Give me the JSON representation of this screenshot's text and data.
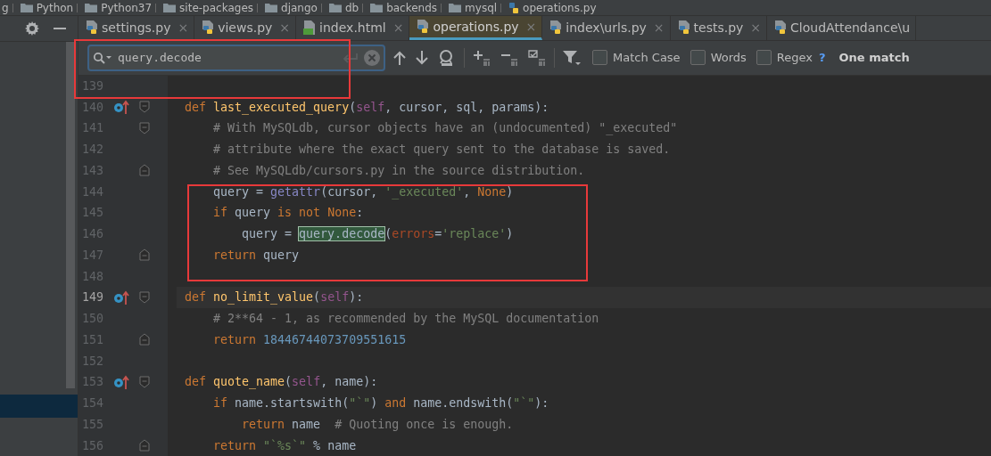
{
  "breadcrumbs": [
    {
      "label": "g",
      "kind": "text"
    },
    {
      "label": "Python",
      "kind": "folder"
    },
    {
      "label": "Python37",
      "kind": "folder"
    },
    {
      "label": "site-packages",
      "kind": "folder"
    },
    {
      "label": "django",
      "kind": "folder"
    },
    {
      "label": "db",
      "kind": "folder"
    },
    {
      "label": "backends",
      "kind": "folder"
    },
    {
      "label": "mysql",
      "kind": "folder"
    },
    {
      "label": "operations.py",
      "kind": "python"
    }
  ],
  "tabs": [
    {
      "label": "settings.py",
      "kind": "python",
      "selected": false,
      "close": "×"
    },
    {
      "label": "views.py",
      "kind": "python",
      "selected": false,
      "close": "×"
    },
    {
      "label": "index.html",
      "kind": "html",
      "selected": false,
      "close": "×"
    },
    {
      "label": "operations.py",
      "kind": "python",
      "selected": true,
      "close": "×"
    },
    {
      "label": "index\\urls.py",
      "kind": "python",
      "selected": false,
      "close": "×"
    },
    {
      "label": "tests.py",
      "kind": "python",
      "selected": false,
      "close": "×"
    },
    {
      "label": "CloudAttendance\\u",
      "kind": "python",
      "selected": false
    }
  ],
  "search": {
    "value": "query.decode",
    "options": [
      {
        "label": "Match Case",
        "checked": false
      },
      {
        "label": "Words",
        "checked": false
      },
      {
        "label": "Regex",
        "checked": false
      }
    ],
    "help": "?",
    "result": "One match"
  },
  "code": {
    "lines": [
      {
        "number": "139"
      },
      {
        "number": "140",
        "marker": true,
        "block_start": true,
        "tokens": [
          {
            "kind": "kw",
            "text": "def "
          },
          {
            "kind": "fn",
            "text": "last_executed_query"
          },
          {
            "kind": "plain",
            "text": "("
          },
          {
            "kind": "self",
            "text": "self"
          },
          {
            "kind": "plain",
            "text": ", cursor, sql, params):"
          }
        ]
      },
      {
        "number": "141",
        "block_start": true,
        "tokens": [
          {
            "kind": "comment",
            "text": "    # With MySQLdb, cursor objects have an (undocumented) \"_executed\""
          }
        ]
      },
      {
        "number": "142",
        "tokens": [
          {
            "kind": "comment",
            "text": "    # attribute where the exact query sent to the database is saved."
          }
        ]
      },
      {
        "number": "143",
        "block_end": true,
        "tokens": [
          {
            "kind": "comment",
            "text": "    # See MySQLdb/cursors.py in the source distribution."
          }
        ]
      },
      {
        "number": "144",
        "tokens": [
          {
            "kind": "plain",
            "text": "    query = "
          },
          {
            "kind": "builtin",
            "text": "getattr"
          },
          {
            "kind": "plain",
            "text": "(cursor, "
          },
          {
            "kind": "string",
            "text": "'_executed'"
          },
          {
            "kind": "plain",
            "text": ", "
          },
          {
            "kind": "kw",
            "text": "None"
          },
          {
            "kind": "plain",
            "text": ")"
          }
        ]
      },
      {
        "number": "145",
        "tokens": [
          {
            "kind": "kw",
            "text": "    if"
          },
          {
            "kind": "plain",
            "text": " query "
          },
          {
            "kind": "kw",
            "text": "is not None"
          },
          {
            "kind": "plain",
            "text": ":"
          }
        ]
      },
      {
        "number": "146",
        "tokens": [
          {
            "kind": "plain",
            "text": "        query = "
          },
          {
            "kind": "match",
            "text": "query.decode"
          },
          {
            "kind": "plain",
            "text": "("
          },
          {
            "kind": "param",
            "text": "errors"
          },
          {
            "kind": "plain",
            "text": "="
          },
          {
            "kind": "string",
            "text": "'replace'"
          },
          {
            "kind": "plain",
            "text": ")"
          }
        ]
      },
      {
        "number": "147",
        "block_end": true,
        "tokens": [
          {
            "kind": "kw",
            "text": "    return"
          },
          {
            "kind": "plain",
            "text": " query"
          }
        ]
      },
      {
        "number": "148"
      },
      {
        "number": "149",
        "marker": true,
        "block_start": true,
        "current": true,
        "tokens": [
          {
            "kind": "kw",
            "text": "def "
          },
          {
            "kind": "fn",
            "text": "no_limit_value"
          },
          {
            "kind": "plain",
            "text": "("
          },
          {
            "kind": "self",
            "text": "self"
          },
          {
            "kind": "plain",
            "text": "):"
          }
        ]
      },
      {
        "number": "150",
        "tokens": [
          {
            "kind": "comment",
            "text": "    # 2**64 - 1, as recommended by the MySQL documentation"
          }
        ]
      },
      {
        "number": "151",
        "block_end": true,
        "tokens": [
          {
            "kind": "kw",
            "text": "    return "
          },
          {
            "kind": "number",
            "text": "18446744073709551615"
          }
        ]
      },
      {
        "number": "152"
      },
      {
        "number": "153",
        "marker": true,
        "block_start": true,
        "tokens": [
          {
            "kind": "kw",
            "text": "def "
          },
          {
            "kind": "fn",
            "text": "quote_name"
          },
          {
            "kind": "plain",
            "text": "("
          },
          {
            "kind": "self",
            "text": "self"
          },
          {
            "kind": "plain",
            "text": ", name):"
          }
        ]
      },
      {
        "number": "154",
        "tokens": [
          {
            "kind": "kw",
            "text": "    if"
          },
          {
            "kind": "plain",
            "text": " name.startswith("
          },
          {
            "kind": "string",
            "text": "\"`\""
          },
          {
            "kind": "plain",
            "text": ") "
          },
          {
            "kind": "kw",
            "text": "and"
          },
          {
            "kind": "plain",
            "text": " name.endswith("
          },
          {
            "kind": "string",
            "text": "\"`\""
          },
          {
            "kind": "plain",
            "text": "):"
          }
        ]
      },
      {
        "number": "155",
        "tokens": [
          {
            "kind": "kw",
            "text": "        return"
          },
          {
            "kind": "plain",
            "text": " name  "
          },
          {
            "kind": "comment",
            "text": "# Quoting once is enough."
          }
        ]
      },
      {
        "number": "156",
        "block_end": true,
        "tokens": [
          {
            "kind": "kw",
            "text": "    return "
          },
          {
            "kind": "string",
            "text": "\"`%s`\""
          },
          {
            "kind": "plain",
            "text": " % name"
          }
        ]
      }
    ]
  }
}
